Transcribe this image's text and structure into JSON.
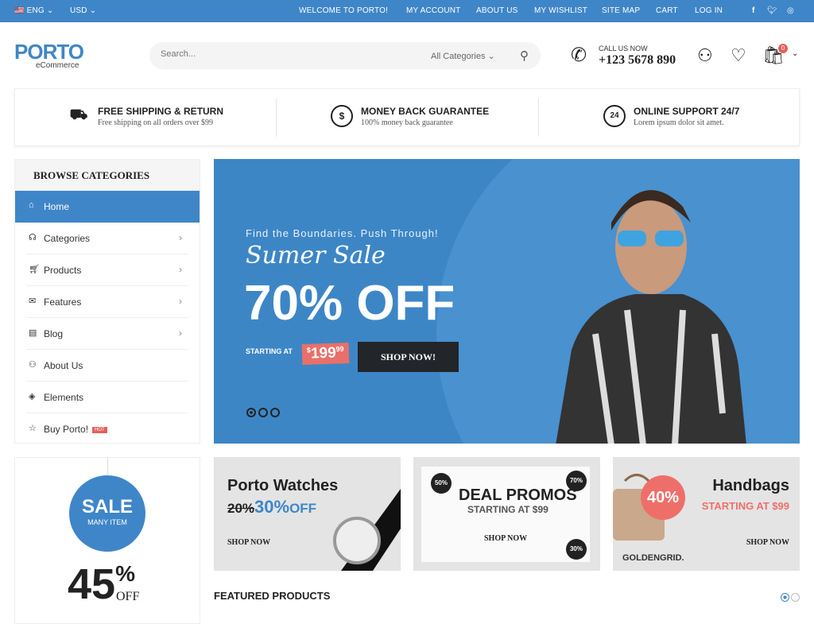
{
  "topbar": {
    "language": "ENG",
    "currency": "USD",
    "links": [
      "WELCOME TO PORTO!",
      "MY ACCOUNT",
      "ABOUT US",
      "MY WISHLIST",
      "SITE MAP",
      "CART",
      "LOG IN"
    ],
    "social": [
      "facebook-icon",
      "twitter-icon",
      "instagram-icon"
    ]
  },
  "header": {
    "logo": "PORTO",
    "logo_sub": "eCommerce",
    "search_placeholder": "Search...",
    "category": "All Categories",
    "call_label": "CALL US NOW",
    "phone": "+123 5678 890",
    "cart_count": "0"
  },
  "features": [
    {
      "title": "FREE SHIPPING & RETURN",
      "sub": "Free shipping on all orders over $99",
      "icon": "truck-icon"
    },
    {
      "title": "MONEY BACK GUARANTEE",
      "sub": "100% money back guarantee",
      "icon": "dollar-icon"
    },
    {
      "title": "ONLINE SUPPORT 24/7",
      "sub": "Lorem ipsum dolor sit amet.",
      "icon": "24h-icon"
    }
  ],
  "sidebar": {
    "title": "BROWSE CATEGORIES",
    "items": [
      {
        "label": "Home"
      },
      {
        "label": "Categories"
      },
      {
        "label": "Products"
      },
      {
        "label": "Features"
      },
      {
        "label": "Blog"
      },
      {
        "label": "About Us"
      },
      {
        "label": "Elements"
      },
      {
        "label": "Buy Porto!",
        "badge": "HOT"
      }
    ]
  },
  "hero": {
    "kicker": "Find the Boundaries. Push Through!",
    "script": "Sumer Sale",
    "headline": "70% OFF",
    "starting": "STARTING AT",
    "price_symbol": "$",
    "price": "199",
    "price_cents": "99",
    "button": "SHOP NOW!",
    "accent": "#3d86c6"
  },
  "sale": {
    "tag": "SALE",
    "tag_sub": "MANY ITEM",
    "percent": "45",
    "pct_sign": "%",
    "off": "OFF"
  },
  "banners": [
    {
      "title": "Porto Watches",
      "old": "20%",
      "new": "30%",
      "off": "OFF",
      "cta": "SHOP NOW"
    },
    {
      "title": "DEAL PROMOS",
      "sub": "STARTING AT $99",
      "cta": "SHOP NOW",
      "badges": [
        "50%",
        "70%",
        "30%"
      ]
    },
    {
      "title": "Handbags",
      "sub": "STARTING AT $99",
      "cta": "SHOP NOW",
      "badge": "40%",
      "brand": "GOLDENGRID."
    }
  ],
  "featured": {
    "title": "FEATURED PRODUCTS"
  }
}
